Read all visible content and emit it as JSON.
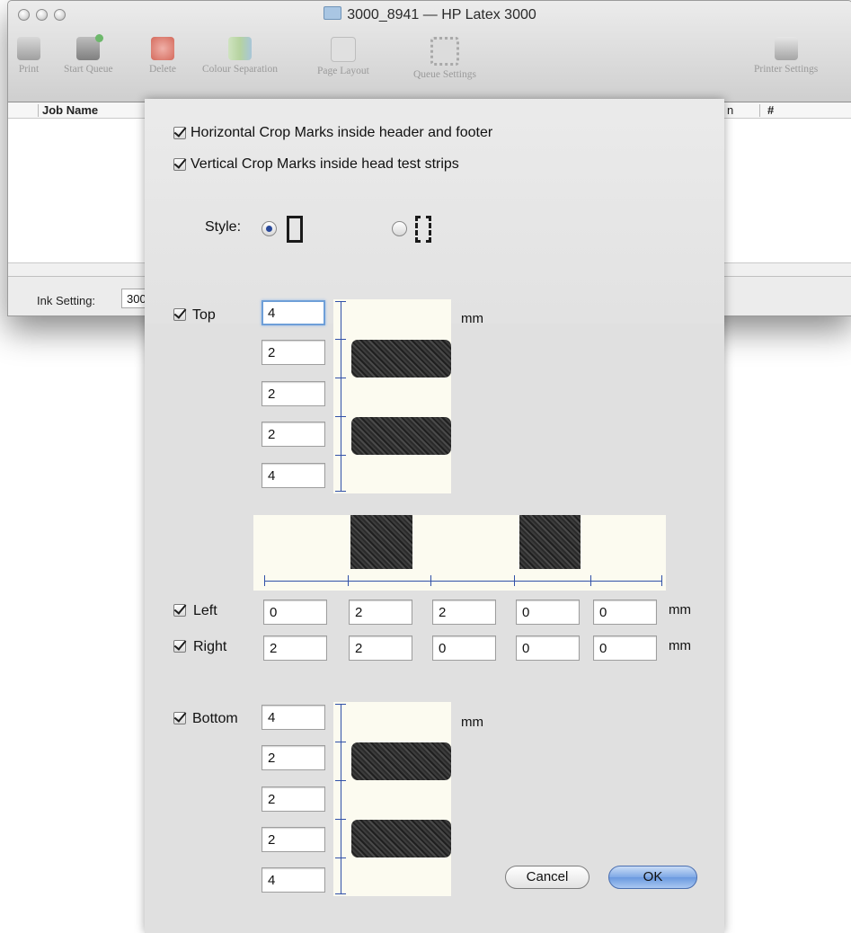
{
  "window": {
    "title": "3000_8941 — HP Latex 3000",
    "toolbar": [
      {
        "label": "Print",
        "icon": "printer-icon"
      },
      {
        "label": "Start Queue",
        "icon": "start-queue-icon"
      },
      {
        "label": "Delete",
        "icon": "delete-icon"
      },
      {
        "label": "Colour Separation",
        "icon": "colour-separation-icon"
      },
      {
        "label": "Page Layout",
        "icon": "page-layout-icon"
      },
      {
        "label": "Queue Settings",
        "icon": "gear-icon"
      },
      {
        "label": "Printer Settings",
        "icon": "printer-settings-icon"
      }
    ],
    "table": {
      "columns": [
        "Job Name",
        "n",
        "#"
      ]
    },
    "ink_setting_label": "Ink Setting:",
    "ink_setting_value": "300"
  },
  "dialog": {
    "horizontal_crop_label": "Horizontal Crop Marks inside header and footer",
    "vertical_crop_label": "Vertical Crop Marks inside head test strips",
    "style_label": "Style:",
    "style_selected": "solid",
    "top": {
      "label": "Top",
      "values": [
        "4",
        "2",
        "2",
        "2",
        "4"
      ],
      "unit": "mm"
    },
    "left": {
      "label": "Left",
      "values": [
        "0",
        "2",
        "2",
        "0",
        "0"
      ],
      "unit": "mm"
    },
    "right": {
      "label": "Right",
      "values": [
        "2",
        "2",
        "0",
        "0",
        "0"
      ],
      "unit": "mm"
    },
    "bottom": {
      "label": "Bottom",
      "values": [
        "4",
        "2",
        "2",
        "2",
        "4"
      ],
      "unit": "mm"
    },
    "cancel_label": "Cancel",
    "ok_label": "OK"
  }
}
